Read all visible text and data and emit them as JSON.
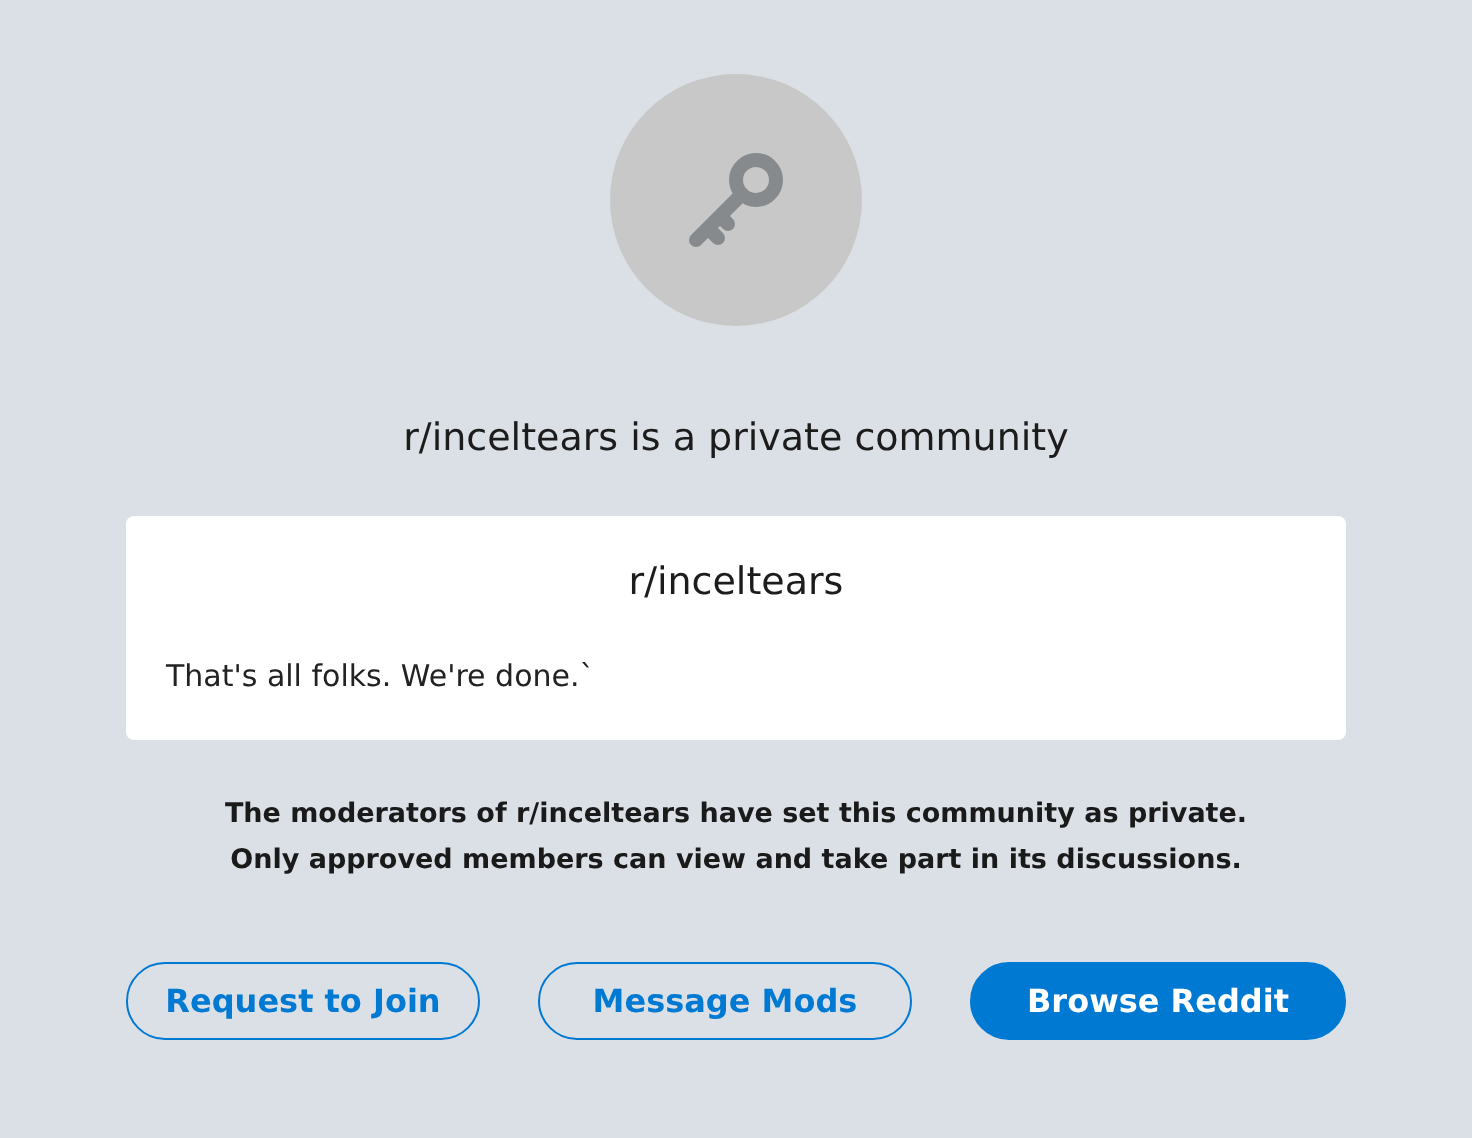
{
  "heading": "r/inceltears is a private community",
  "card": {
    "title": "r/inceltears",
    "description": "That's all folks. We're done.`"
  },
  "notice": [
    "The moderators of r/inceltears have set this community as private.",
    "Only approved members can view and take part in its discussions."
  ],
  "buttons": [
    {
      "label": "Request to Join",
      "kind": "outline"
    },
    {
      "label": "Message Mods",
      "kind": "outline"
    },
    {
      "label": "Browse Reddit",
      "kind": "filled"
    }
  ]
}
